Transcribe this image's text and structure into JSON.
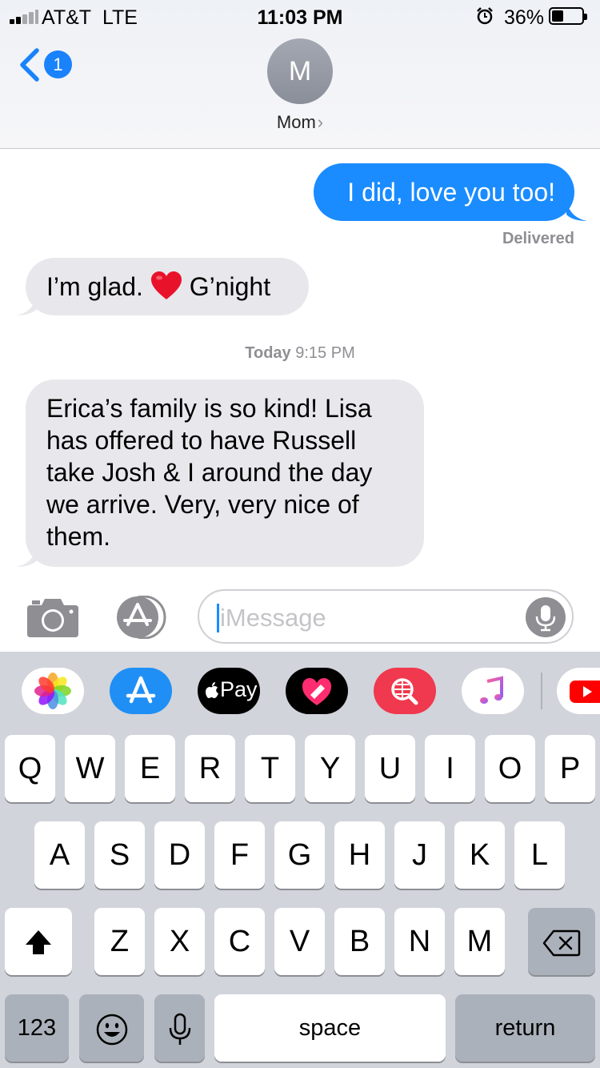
{
  "status_bar": {
    "carrier": "AT&T",
    "network": "LTE",
    "time": "11:03 PM",
    "battery_percent": "36%",
    "battery_level": 0.36,
    "signal_bars": 2,
    "icons": [
      "signal-bars-icon",
      "alarm-icon",
      "battery-icon"
    ]
  },
  "nav": {
    "back_badge": "1",
    "contact_initial": "M",
    "contact_name": "Mom",
    "contact_chevron": "›"
  },
  "messages": [
    {
      "direction": "sent",
      "text": "I did, love you too!"
    },
    {
      "direction": "received",
      "text_before": "I’m glad.",
      "emoji": "red-heart",
      "text_after": "G’night"
    },
    {
      "direction": "received",
      "lines": [
        "Erica’s family is so kind!  Lisa",
        "has offered to have Russell",
        "take Josh & I around the day",
        "we arrive. Very, very nice of",
        "them."
      ]
    }
  ],
  "delivered_label": "Delivered",
  "timestamp": {
    "day": "Today",
    "time": "9:15 PM"
  },
  "compose": {
    "placeholder": "iMessage",
    "icons": [
      "camera-icon",
      "app-store-icon",
      "microphone-icon"
    ]
  },
  "app_tray": {
    "apps": [
      "photos-app-icon",
      "app-store-app-icon",
      "apple-pay-app-icon",
      "digital-touch-app-icon",
      "images-search-app-icon",
      "music-app-icon",
      "youtube-app-icon"
    ],
    "apple_pay_label": "Pay"
  },
  "keyboard": {
    "row1": [
      "Q",
      "W",
      "E",
      "R",
      "T",
      "Y",
      "U",
      "I",
      "O",
      "P"
    ],
    "row2": [
      "A",
      "S",
      "D",
      "F",
      "G",
      "H",
      "J",
      "K",
      "L"
    ],
    "row3": [
      "Z",
      "X",
      "C",
      "V",
      "B",
      "N",
      "M"
    ],
    "numbers_key": "123",
    "space_key": "space",
    "return_key": "return",
    "icons": [
      "shift-icon",
      "backspace-icon",
      "emoji-icon",
      "dictation-icon"
    ]
  },
  "colors": {
    "sent_bubble": "#1a8cff",
    "received_bubble": "#e8e8ec",
    "accent": "#1a82fb",
    "keyboard_bg": "#d1d4db"
  }
}
